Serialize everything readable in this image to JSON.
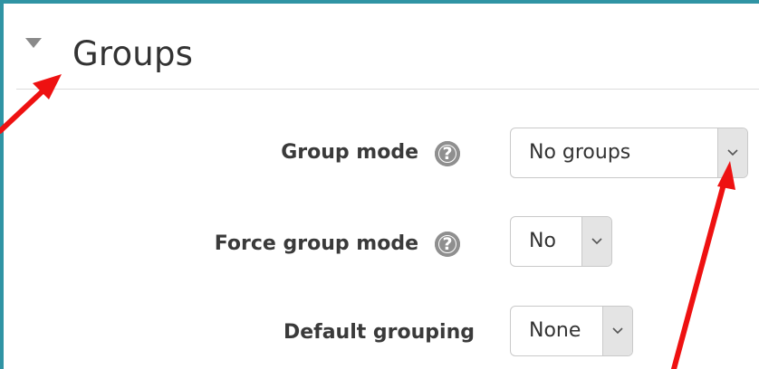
{
  "section": {
    "title": "Groups"
  },
  "fields": {
    "group_mode": {
      "label": "Group mode",
      "value": "No groups"
    },
    "force_group_mode": {
      "label": "Force group mode",
      "value": "No"
    },
    "default_grouping": {
      "label": "Default grouping",
      "value": "None"
    }
  },
  "icons": {
    "collapse": "triangle-down-icon",
    "help": "question-circle-icon",
    "dropdown": "chevron-down-icon"
  },
  "colors": {
    "frame_border": "#3094a4",
    "annotation_arrow": "#ee1111",
    "dropdown_button_bg": "#e4e4e4"
  }
}
